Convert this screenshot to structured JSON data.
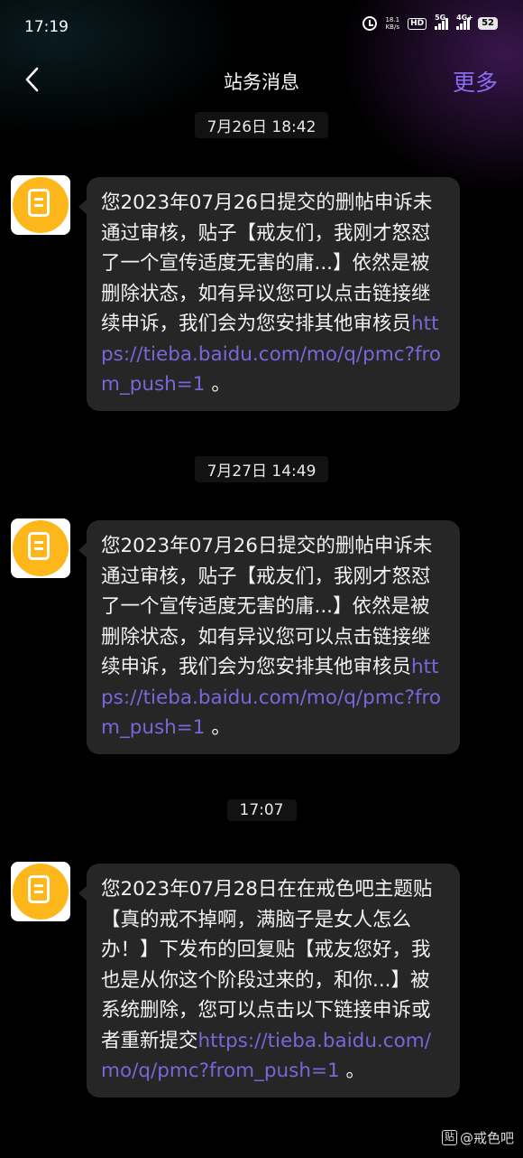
{
  "status_bar": {
    "time": "17:19",
    "net_speed_value": "18.1",
    "net_speed_unit": "KB/s",
    "hd_label": "HD",
    "signal1_label": "5G",
    "signal2_label": "4G+",
    "battery": "52"
  },
  "nav": {
    "title": "站务消息",
    "more_label": "更多"
  },
  "messages": [
    {
      "timestamp": "7月26日 18:42",
      "text": "您2023年07月26日提交的删帖申诉未通过审核，贴子【戒友们，我刚才怒怼了一个宣传适度无害的庸...】依然是被删除状态，如有异议您可以点击链接继续申诉，我们会为您安排其他审核员",
      "link": "https://tieba.baidu.com/mo/q/pmc?from_push=1",
      "tail": " 。"
    },
    {
      "timestamp": "7月27日 14:49",
      "text": "您2023年07月26日提交的删帖申诉未通过审核，贴子【戒友们，我刚才怒怼了一个宣传适度无害的庸...】依然是被删除状态，如有异议您可以点击链接继续申诉，我们会为您安排其他审核员",
      "link": "https://tieba.baidu.com/mo/q/pmc?from_push=1",
      "tail": " 。"
    },
    {
      "timestamp": "17:07",
      "text": "您2023年07月28日在在戒色吧主题贴【真的戒不掉啊，满脑子是女人怎么办！】下发布的回复贴【戒友您好，我也是从你这个阶段过来的，和你...】被系统删除，您可以点击以下链接申诉或者重新提交",
      "link": "https://tieba.baidu.com/mo/q/pmc?from_push=1",
      "tail": " 。"
    }
  ],
  "watermark": {
    "icon_text": "贴",
    "text": "@戒色吧"
  },
  "colors": {
    "accent": "#8a6cf2",
    "link": "#7b66d9",
    "bubble": "#262626",
    "avatar": "#fdb71a"
  }
}
